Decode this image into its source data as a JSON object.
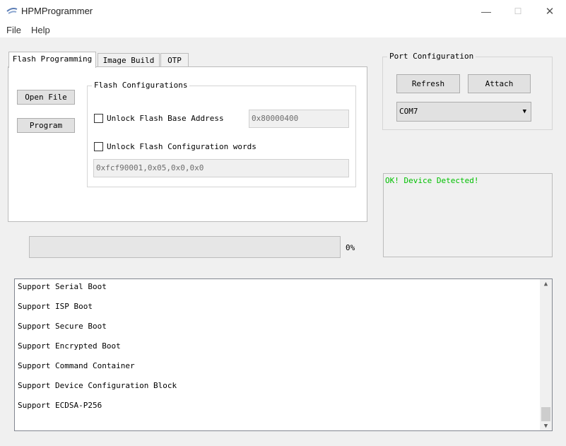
{
  "window": {
    "title": "HPMProgrammer",
    "minimize": "—",
    "maximize": "☐",
    "close": "✕"
  },
  "menu": {
    "file": "File",
    "help": "Help"
  },
  "tabs": [
    {
      "label": "Flash Programming"
    },
    {
      "label": "Image Build"
    },
    {
      "label": "OTP"
    }
  ],
  "flash": {
    "open_file": "Open File",
    "program": "Program",
    "group_title": "Flash Configurations",
    "unlock_base_label": "Unlock Flash Base Address",
    "base_address_value": "0x80000400",
    "unlock_words_label": "Unlock Flash Configuration words",
    "config_words_value": "0xfcf90001,0x05,0x0,0x0"
  },
  "progress": {
    "value": 0,
    "label": "0%"
  },
  "port": {
    "group_title": "Port Configuration",
    "refresh": "Refresh",
    "attach": "Attach",
    "selected_port": "COM7",
    "status_text": "OK! Device Detected!",
    "status_color": "#00c000"
  },
  "log": {
    "lines": [
      "Support Serial Boot",
      "Support ISP Boot",
      "Support Secure Boot",
      "Support Encrypted Boot",
      "Support Command Container",
      "Support Device Configuration Block",
      "Support ECDSA-P256"
    ],
    "scroll_up": "▲",
    "scroll_down": "▼"
  }
}
